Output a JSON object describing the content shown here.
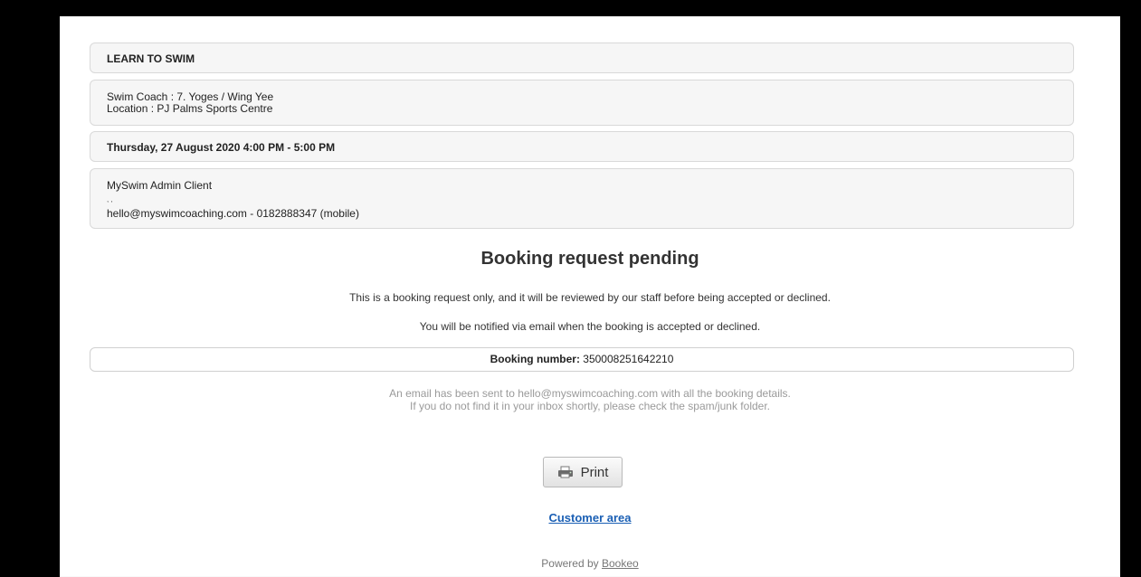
{
  "service": {
    "title": "LEARN TO SWIM"
  },
  "details": {
    "coach": "Swim Coach : 7. Yoges / Wing Yee",
    "location": "Location : PJ Palms Sports Centre"
  },
  "schedule": {
    "datetime": "Thursday, 27 August 2020 4:00 PM - 5:00 PM"
  },
  "customer": {
    "name": "MySwim Admin Client",
    "blank_line": ", ,",
    "contact": "hello@myswimcoaching.com - 0182888347 (mobile)"
  },
  "status": {
    "heading": "Booking request pending",
    "message1": "This is a booking request only, and it will be reviewed by our staff before being accepted or declined.",
    "message2": "You will be notified via email when the booking is accepted or declined."
  },
  "booking": {
    "number_label": "Booking number:",
    "number": "350008251642210"
  },
  "email_note": {
    "line1": "An email has been sent to hello@myswimcoaching.com with all the booking details.",
    "line2": "If you do not find it in your inbox shortly, please check the spam/junk folder."
  },
  "actions": {
    "print_label": "Print",
    "print_icon": "printer-icon",
    "customer_area_label": "Customer area"
  },
  "footer": {
    "powered_prefix": "Powered by",
    "powered_link": "Bookeo"
  }
}
